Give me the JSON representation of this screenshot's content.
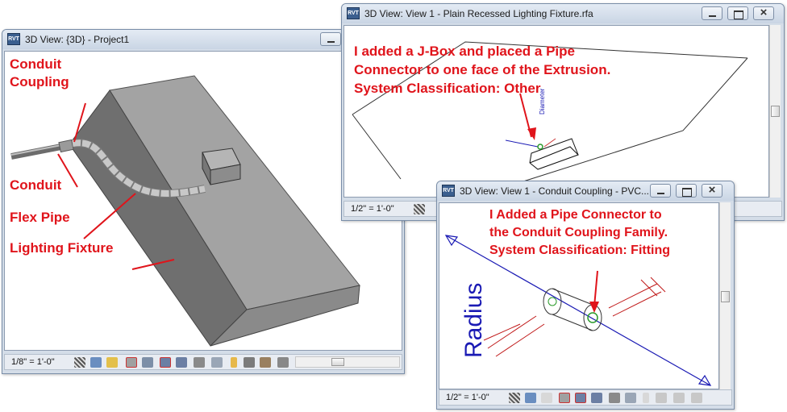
{
  "windows": {
    "project": {
      "title": "3D View: {3D} - Project1",
      "scale": "1/8\" = 1'-0\"",
      "annotations": {
        "conduit_coupling_1": "Conduit",
        "conduit_coupling_2": "Coupling",
        "conduit": "Conduit",
        "flex_pipe": "Flex Pipe",
        "lighting_fixture": "Lighting Fixture"
      }
    },
    "lighting": {
      "title": "3D View: View 1 - Plain Recessed Lighting Fixture.rfa",
      "scale": "1/2\" = 1'-0\"",
      "note_line1": "I added a J-Box and placed a Pipe",
      "note_line2": "Connector to one face of the Extrusion.",
      "note_line3": "System Classification: Other",
      "dimension_label": "Diameter"
    },
    "coupling": {
      "title": "3D View: View 1 - Conduit Coupling - PVC...",
      "scale": "1/2\" = 1'-0\"",
      "note_line1": "I Added a Pipe Connector to",
      "note_line2": "the Conduit Coupling Family.",
      "note_line3": "System Classification: Fitting",
      "radius_label": "Radius"
    }
  },
  "app_icon_label": "RVT",
  "colors": {
    "annotation_red": "#e0141b",
    "radius_blue": "#1a1ab4",
    "model_gray": "#8a8a8a"
  }
}
